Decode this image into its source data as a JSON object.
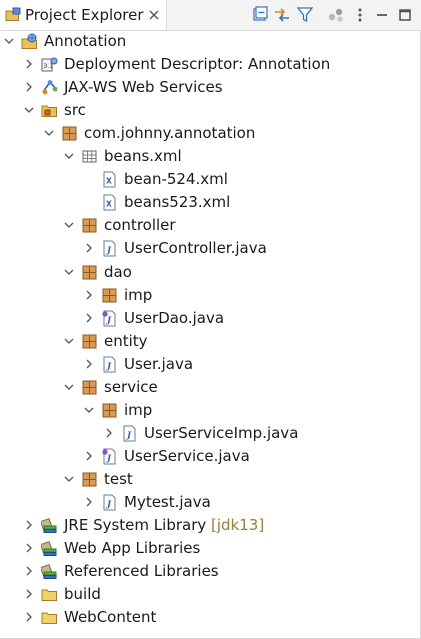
{
  "view": {
    "title": "Project Explorer",
    "accent": "#2a62b8"
  },
  "toolbar": [
    {
      "name": "collapse-all-button",
      "icon": "collapse-all-icon"
    },
    {
      "name": "link-with-editor-button",
      "icon": "link-with-editor-icon"
    },
    {
      "name": "filter-button",
      "icon": "filter-icon"
    },
    {
      "name": "working-sets-button",
      "icon": "working-sets-icon"
    },
    {
      "name": "view-menu-button",
      "icon": "view-menu-icon"
    },
    {
      "name": "minimize-button",
      "icon": "minimize-icon"
    },
    {
      "name": "maximize-button",
      "icon": "maximize-icon"
    }
  ],
  "tree": [
    {
      "label": "Annotation",
      "depth": 0,
      "expanded": true,
      "icon": "web-project-icon"
    },
    {
      "label": "Deployment Descriptor: Annotation",
      "depth": 1,
      "expanded": false,
      "icon": "deployment-descriptor-icon"
    },
    {
      "label": "JAX-WS Web Services",
      "depth": 1,
      "expanded": false,
      "icon": "web-services-icon"
    },
    {
      "label": "src",
      "depth": 1,
      "expanded": true,
      "icon": "source-folder-icon"
    },
    {
      "label": "com.johnny.annotation",
      "depth": 2,
      "expanded": true,
      "icon": "package-icon"
    },
    {
      "label": "beans.xml",
      "depth": 3,
      "expanded": true,
      "icon": "spring-beans-icon"
    },
    {
      "label": "bean-524.xml",
      "depth": 4,
      "expanded": null,
      "icon": "xml-file-icon"
    },
    {
      "label": "beans523.xml",
      "depth": 4,
      "expanded": null,
      "icon": "xml-file-icon"
    },
    {
      "label": "controller",
      "depth": 3,
      "expanded": true,
      "icon": "package-icon"
    },
    {
      "label": "UserController.java",
      "depth": 4,
      "expanded": false,
      "icon": "java-file-icon"
    },
    {
      "label": "dao",
      "depth": 3,
      "expanded": true,
      "icon": "package-icon"
    },
    {
      "label": "imp",
      "depth": 4,
      "expanded": false,
      "icon": "package-icon"
    },
    {
      "label": "UserDao.java",
      "depth": 4,
      "expanded": false,
      "icon": "java-interface-file-icon"
    },
    {
      "label": "entity",
      "depth": 3,
      "expanded": true,
      "icon": "package-icon"
    },
    {
      "label": "User.java",
      "depth": 4,
      "expanded": false,
      "icon": "java-file-icon"
    },
    {
      "label": "service",
      "depth": 3,
      "expanded": true,
      "icon": "package-icon"
    },
    {
      "label": "imp",
      "depth": 4,
      "expanded": true,
      "icon": "package-icon"
    },
    {
      "label": "UserServiceImp.java",
      "depth": 5,
      "expanded": false,
      "icon": "java-file-icon"
    },
    {
      "label": "UserService.java",
      "depth": 4,
      "expanded": false,
      "icon": "java-interface-file-icon"
    },
    {
      "label": "test",
      "depth": 3,
      "expanded": true,
      "icon": "package-icon"
    },
    {
      "label": "Mytest.java",
      "depth": 4,
      "expanded": false,
      "icon": "java-file-icon"
    },
    {
      "label": "JRE System Library",
      "decoration": "[jdk13]",
      "depth": 1,
      "expanded": false,
      "icon": "library-icon"
    },
    {
      "label": "Web App Libraries",
      "depth": 1,
      "expanded": false,
      "icon": "library-icon"
    },
    {
      "label": "Referenced Libraries",
      "depth": 1,
      "expanded": false,
      "icon": "library-icon"
    },
    {
      "label": "build",
      "depth": 1,
      "expanded": false,
      "icon": "folder-icon"
    },
    {
      "label": "WebContent",
      "depth": 1,
      "expanded": false,
      "icon": "folder-icon"
    }
  ]
}
